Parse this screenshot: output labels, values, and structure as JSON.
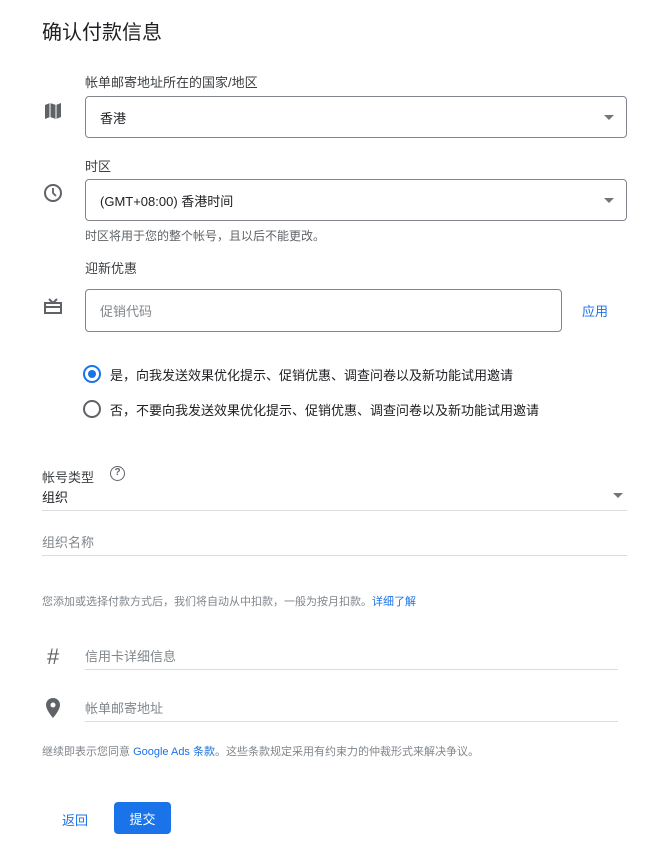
{
  "title": "确认付款信息",
  "country": {
    "label": "帐单邮寄地址所在的国家/地区",
    "value": "香港"
  },
  "timezone": {
    "label": "时区",
    "value": "(GMT+08:00) 香港时间",
    "help": "时区将用于您的整个帐号，且以后不能更改。"
  },
  "promo": {
    "label": "迎新优惠",
    "placeholder": "促销代码",
    "apply": "应用"
  },
  "emails": {
    "yes": "是，向我发送效果优化提示、促销优惠、调查问卷以及新功能试用邀请",
    "no": "否，不要向我发送效果优化提示、促销优惠、调查问卷以及新功能试用邀请"
  },
  "account_type": {
    "label": "帐号类型",
    "value": "组织",
    "help_icon": "?"
  },
  "org_name": {
    "placeholder": "组织名称"
  },
  "billing_note": {
    "text": "您添加或选择付款方式后，我们将自动从中扣款，一般为按月扣款。",
    "link": "详细了解"
  },
  "card": {
    "icon": "#",
    "placeholder": "信用卡详细信息"
  },
  "address": {
    "placeholder": "帐单邮寄地址"
  },
  "terms": {
    "prefix": "继续即表示您同意 ",
    "link": "Google Ads 条款",
    "suffix": "。这些条款规定采用有约束力的仲裁形式来解决争议。"
  },
  "actions": {
    "back": "返回",
    "submit": "提交"
  }
}
